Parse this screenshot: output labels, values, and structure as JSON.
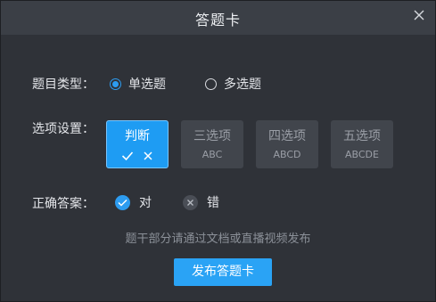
{
  "dialog": {
    "title": "答题卡"
  },
  "question_type": {
    "label": "题目类型：",
    "options": [
      {
        "label": "单选题",
        "checked": true
      },
      {
        "label": "多选题",
        "checked": false
      }
    ]
  },
  "option_settings": {
    "label": "选项设置：",
    "options": [
      {
        "label": "判断",
        "sub": "",
        "active": true
      },
      {
        "label": "三选项",
        "sub": "ABC",
        "active": false
      },
      {
        "label": "四选项",
        "sub": "ABCD",
        "active": false
      },
      {
        "label": "五选项",
        "sub": "ABCDE",
        "active": false
      }
    ]
  },
  "correct_answer": {
    "label": "正确答案：",
    "options": [
      {
        "label": "对",
        "selected": true
      },
      {
        "label": "错",
        "selected": false
      }
    ]
  },
  "hint": "题干部分请通过文档或直播视频发布",
  "publish_button": "发布答题卡",
  "colors": {
    "accent": "#2d9cf0",
    "background": "#2f3238",
    "titlebar": "#3b3f46"
  }
}
